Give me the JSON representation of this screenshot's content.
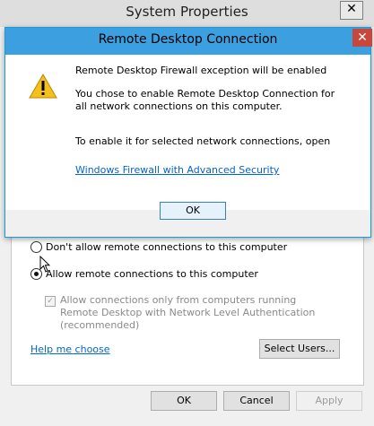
{
  "system_properties": {
    "title": "System Properties",
    "close_glyph": "✕",
    "options": [
      {
        "label": "Don't allow remote connections to this computer",
        "selected": false
      },
      {
        "label": "Allow remote connections to this computer",
        "selected": true
      }
    ],
    "nla_checkbox": {
      "label": "Allow connections only from computers running Remote Desktop with Network Level Authentication (recommended)",
      "checked": true,
      "enabled": false
    },
    "help_link": "Help me choose",
    "select_users_label": "Select Users...",
    "footer": {
      "ok": "OK",
      "cancel": "Cancel",
      "apply": "Apply"
    }
  },
  "dialog": {
    "title": "Remote Desktop Connection",
    "close_glyph": "✕",
    "icon": "warning-icon",
    "line1": "Remote Desktop Firewall exception will be enabled",
    "line2a": "You chose to enable Remote Desktop Connection for",
    "line2b": "all network connections on this computer.",
    "line3": "To enable it for selected network connections, open",
    "link": "Windows Firewall with Advanced Security",
    "ok": "OK"
  },
  "colors": {
    "dialog_titlebar": "#3c9fe0",
    "close_button": "#c7473d",
    "link": "#0066cc"
  }
}
